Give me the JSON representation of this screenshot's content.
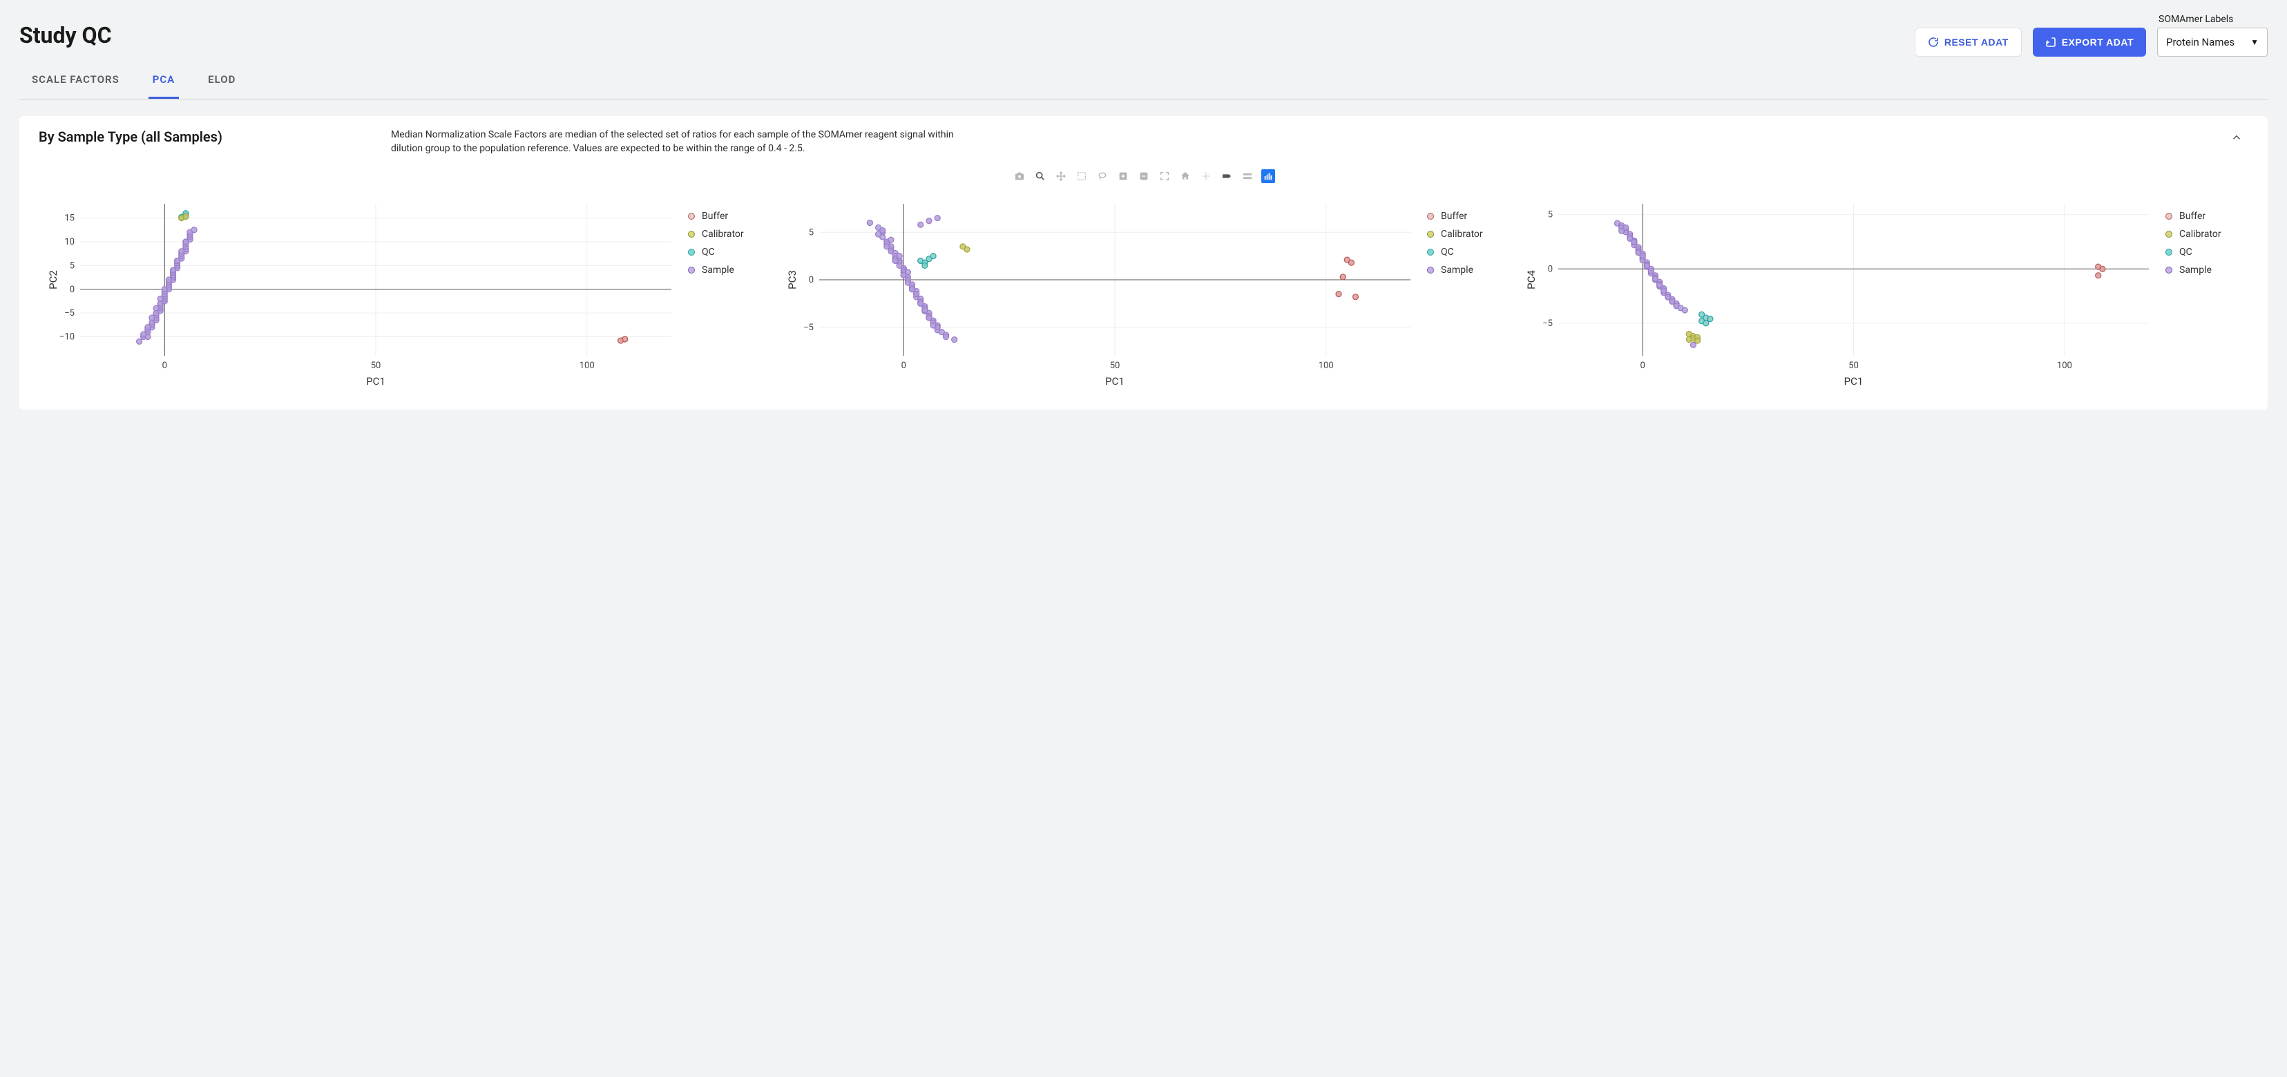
{
  "page_title": "Study QC",
  "topbar": {
    "reset_label": "RESET ADAT",
    "export_label": "EXPORT ADAT",
    "labels_caption": "SOMAmer Labels",
    "labels_value": "Protein Names"
  },
  "tabs": {
    "scale_factors": "SCALE FACTORS",
    "pca": "PCA",
    "elod": "ELOD"
  },
  "panel": {
    "title": "By Sample Type (all Samples)",
    "desc": "Median Normalization Scale Factors are median of the selected set of ratios for each sample of the SOMAmer reagent signal within dilution group to the population reference. Values are expected to be within the range of 0.4 - 2.5."
  },
  "chart_data": [
    {
      "type": "scatter",
      "xlim": [
        -20,
        120
      ],
      "ylim": [
        -14,
        18
      ],
      "xticks": [
        0,
        50,
        100
      ],
      "yticks": [
        -10,
        -5,
        0,
        5,
        10,
        15
      ],
      "xlabel": "PC1",
      "ylabel": "PC2",
      "legend": [
        "Buffer",
        "Calibrator",
        "QC",
        "Sample"
      ],
      "series": [
        {
          "name": "Sample",
          "color": "#9a7ec8",
          "points": [
            [
              -6,
              -11
            ],
            [
              -5,
              -10
            ],
            [
              -4,
              -10
            ],
            [
              -4,
              -9
            ],
            [
              -4,
              -8.5
            ],
            [
              -3,
              -8
            ],
            [
              -3,
              -7.5
            ],
            [
              -3,
              -7
            ],
            [
              -2,
              -6.5
            ],
            [
              -2,
              -6
            ],
            [
              -2,
              -5.5
            ],
            [
              -2,
              -5
            ],
            [
              -1,
              -4.5
            ],
            [
              -1,
              -4
            ],
            [
              -1,
              -3.5
            ],
            [
              -1,
              -3
            ],
            [
              0,
              -2.5
            ],
            [
              0,
              -2
            ],
            [
              0,
              -1.5
            ],
            [
              0,
              -1
            ],
            [
              0,
              -0.5
            ],
            [
              1,
              0
            ],
            [
              1,
              0.5
            ],
            [
              1,
              1
            ],
            [
              1,
              1.5
            ],
            [
              2,
              2
            ],
            [
              2,
              2.5
            ],
            [
              2,
              3
            ],
            [
              2,
              3.5
            ],
            [
              2,
              4
            ],
            [
              3,
              4.5
            ],
            [
              3,
              5
            ],
            [
              3,
              5.5
            ],
            [
              3,
              6
            ],
            [
              4,
              6.5
            ],
            [
              4,
              7
            ],
            [
              4,
              7.5
            ],
            [
              5,
              8
            ],
            [
              5,
              8.5
            ],
            [
              5,
              9
            ],
            [
              5,
              9.5
            ],
            [
              5,
              10
            ],
            [
              6,
              10.5
            ],
            [
              6,
              11
            ],
            [
              6,
              11.5
            ],
            [
              6,
              12
            ],
            [
              7,
              12.5
            ],
            [
              -5,
              -9.5
            ],
            [
              -4,
              -8
            ],
            [
              -3,
              -6
            ],
            [
              -2,
              -4
            ],
            [
              -1,
              -2
            ],
            [
              0,
              0
            ],
            [
              1,
              2
            ],
            [
              2,
              4
            ],
            [
              3,
              6
            ],
            [
              4,
              8
            ],
            [
              5,
              10
            ]
          ]
        },
        {
          "name": "QC",
          "color": "#2aa8a8",
          "points": [
            [
              4,
              15.2
            ],
            [
              5,
              15.6
            ],
            [
              5,
              16
            ]
          ]
        },
        {
          "name": "Calibrator",
          "color": "#a8a83a",
          "points": [
            [
              4,
              15
            ],
            [
              5,
              15.3
            ]
          ]
        },
        {
          "name": "Buffer",
          "color": "#c05b5b",
          "points": [
            [
              108,
              -10.8
            ],
            [
              109,
              -10.5
            ]
          ]
        }
      ]
    },
    {
      "type": "scatter",
      "xlim": [
        -20,
        120
      ],
      "ylim": [
        -8,
        8
      ],
      "xticks": [
        0,
        50,
        100
      ],
      "yticks": [
        -5,
        0,
        5
      ],
      "xlabel": "PC1",
      "ylabel": "PC3",
      "legend": [
        "Buffer",
        "Calibrator",
        "QC",
        "Sample"
      ],
      "series": [
        {
          "name": "Sample",
          "color": "#9a7ec8",
          "points": [
            [
              -8,
              6
            ],
            [
              -6,
              5.5
            ],
            [
              -5,
              5
            ],
            [
              -5,
              4.5
            ],
            [
              -4,
              4
            ],
            [
              -4,
              3.8
            ],
            [
              -3,
              3.5
            ],
            [
              -3,
              3.2
            ],
            [
              -3,
              3
            ],
            [
              -2,
              2.8
            ],
            [
              -2,
              2.5
            ],
            [
              -2,
              2.2
            ],
            [
              -1,
              2
            ],
            [
              -1,
              1.8
            ],
            [
              -1,
              1.5
            ],
            [
              0,
              1.2
            ],
            [
              0,
              1
            ],
            [
              0,
              0.8
            ],
            [
              0,
              0.5
            ],
            [
              1,
              0.3
            ],
            [
              1,
              0
            ],
            [
              1,
              -0.3
            ],
            [
              2,
              -0.5
            ],
            [
              2,
              -0.8
            ],
            [
              2,
              -1
            ],
            [
              3,
              -1.2
            ],
            [
              3,
              -1.5
            ],
            [
              3,
              -1.8
            ],
            [
              4,
              -2
            ],
            [
              4,
              -2.3
            ],
            [
              4,
              -2.5
            ],
            [
              5,
              -2.8
            ],
            [
              5,
              -3
            ],
            [
              5,
              -3.3
            ],
            [
              6,
              -3.5
            ],
            [
              6,
              -3.8
            ],
            [
              6,
              -4
            ],
            [
              7,
              -4.3
            ],
            [
              7,
              -4.5
            ],
            [
              8,
              -4.8
            ],
            [
              8,
              -5
            ],
            [
              8,
              -5.3
            ],
            [
              9,
              -5.5
            ],
            [
              10,
              -5.8
            ],
            [
              10,
              -6
            ],
            [
              12,
              -6.3
            ],
            [
              -6,
              4.8
            ],
            [
              -4,
              3.5
            ],
            [
              -2,
              2
            ],
            [
              0,
              0.5
            ],
            [
              2,
              -1
            ],
            [
              4,
              -2.5
            ],
            [
              6,
              -4
            ],
            [
              8,
              -5
            ],
            [
              -3,
              4.2
            ],
            [
              -1,
              2.5
            ],
            [
              1,
              0.8
            ],
            [
              3,
              -1.5
            ],
            [
              5,
              -3.2
            ],
            [
              7,
              -4.8
            ],
            [
              -5,
              5.2
            ],
            [
              4,
              5.8
            ],
            [
              6,
              6.2
            ],
            [
              8,
              6.5
            ]
          ]
        },
        {
          "name": "QC",
          "color": "#2aa8a8",
          "points": [
            [
              4,
              2
            ],
            [
              5,
              1.8
            ],
            [
              6,
              2.2
            ],
            [
              5,
              1.5
            ],
            [
              7,
              2.5
            ]
          ]
        },
        {
          "name": "Calibrator",
          "color": "#a8a83a",
          "points": [
            [
              14,
              3.5
            ],
            [
              15,
              3.2
            ]
          ]
        },
        {
          "name": "Buffer",
          "color": "#c05b5b",
          "points": [
            [
              105,
              2.1
            ],
            [
              106,
              1.8
            ],
            [
              104,
              0.3
            ],
            [
              107,
              -1.8
            ],
            [
              103,
              -1.5
            ]
          ]
        }
      ]
    },
    {
      "type": "scatter",
      "xlim": [
        -20,
        120
      ],
      "ylim": [
        -8,
        6
      ],
      "xticks": [
        0,
        50,
        100
      ],
      "yticks": [
        -5,
        0,
        5
      ],
      "xlabel": "PC1",
      "ylabel": "PC4",
      "legend": [
        "Buffer",
        "Calibrator",
        "QC",
        "Sample"
      ],
      "series": [
        {
          "name": "Sample",
          "color": "#9a7ec8",
          "points": [
            [
              -6,
              4.2
            ],
            [
              -5,
              4
            ],
            [
              -5,
              3.8
            ],
            [
              -4,
              3.6
            ],
            [
              -4,
              3.4
            ],
            [
              -3,
              3.2
            ],
            [
              -3,
              3
            ],
            [
              -3,
              2.8
            ],
            [
              -2,
              2.6
            ],
            [
              -2,
              2.4
            ],
            [
              -2,
              2.2
            ],
            [
              -1,
              2
            ],
            [
              -1,
              1.8
            ],
            [
              -1,
              1.6
            ],
            [
              0,
              1.4
            ],
            [
              0,
              1.2
            ],
            [
              0,
              1
            ],
            [
              0,
              0.8
            ],
            [
              1,
              0.6
            ],
            [
              1,
              0.4
            ],
            [
              1,
              0.2
            ],
            [
              2,
              0
            ],
            [
              2,
              -0.2
            ],
            [
              2,
              -0.4
            ],
            [
              3,
              -0.6
            ],
            [
              3,
              -0.8
            ],
            [
              3,
              -1
            ],
            [
              4,
              -1.2
            ],
            [
              4,
              -1.4
            ],
            [
              4,
              -1.6
            ],
            [
              5,
              -1.8
            ],
            [
              5,
              -2
            ],
            [
              5,
              -2.2
            ],
            [
              6,
              -2.4
            ],
            [
              6,
              -2.6
            ],
            [
              7,
              -2.8
            ],
            [
              7,
              -3
            ],
            [
              8,
              -3.2
            ],
            [
              8,
              -3.4
            ],
            [
              9,
              -3.6
            ],
            [
              10,
              -3.8
            ],
            [
              12,
              -7
            ],
            [
              -4,
              3.8
            ],
            [
              -2,
              2.5
            ],
            [
              0,
              1.2
            ],
            [
              2,
              -0.2
            ],
            [
              4,
              -1.5
            ],
            [
              6,
              -2.6
            ],
            [
              8,
              -3.4
            ],
            [
              -5,
              3.5
            ],
            [
              -3,
              2.8
            ],
            [
              -1,
              1.5
            ],
            [
              1,
              0.3
            ],
            [
              3,
              -0.9
            ],
            [
              5,
              -2
            ],
            [
              7,
              -3
            ]
          ]
        },
        {
          "name": "QC",
          "color": "#2aa8a8",
          "points": [
            [
              14,
              -4.2
            ],
            [
              15,
              -4.5
            ],
            [
              14,
              -4.8
            ],
            [
              16,
              -4.6
            ],
            [
              15,
              -5
            ]
          ]
        },
        {
          "name": "Calibrator",
          "color": "#a8a83a",
          "points": [
            [
              11,
              -6
            ],
            [
              12,
              -6.2
            ],
            [
              12,
              -6.4
            ],
            [
              13,
              -6.3
            ],
            [
              11,
              -6.5
            ],
            [
              13,
              -6.6
            ]
          ]
        },
        {
          "name": "Buffer",
          "color": "#c05b5b",
          "points": [
            [
              108,
              0.2
            ],
            [
              109,
              0
            ],
            [
              108,
              -0.6
            ]
          ]
        }
      ]
    }
  ]
}
